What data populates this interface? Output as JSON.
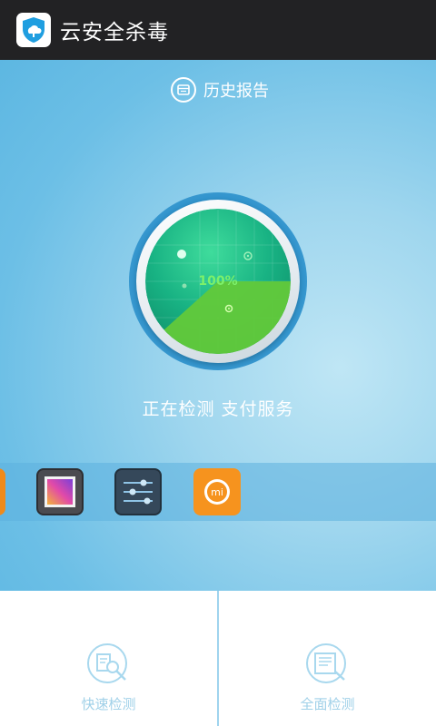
{
  "titlebar": {
    "title": "云安全杀毒",
    "icon": "shield-cloud-icon"
  },
  "history": {
    "label": "历史报告",
    "icon": "report-icon"
  },
  "scan": {
    "progress_text": "100%",
    "progress": 1.0
  },
  "status": {
    "text": "正在检测 支付服务"
  },
  "app_strip": {
    "apps": [
      "orange-app-icon",
      "gallery-app-icon",
      "settings-app-icon",
      "mi-app-icon"
    ]
  },
  "actions": {
    "quick": {
      "label": "快速检测",
      "icon": "quick-scan-icon"
    },
    "full": {
      "label": "全面检测",
      "icon": "full-scan-icon"
    }
  },
  "colors": {
    "titlebar": "#222224",
    "accent": "#5db7e2",
    "label": "#9fd0e8"
  }
}
